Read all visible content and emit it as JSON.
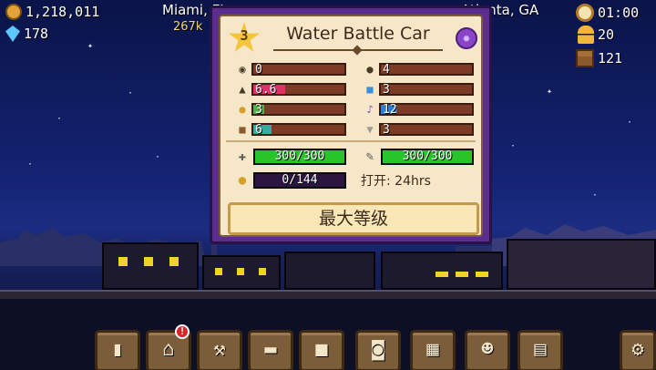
{
  "hud": {
    "coins": "1,218,011",
    "gems": "178",
    "time": "01:00",
    "passengers": "20",
    "cargo": "121"
  },
  "route": {
    "city_left": "Miami, FL",
    "distance": "267k",
    "city_right": "Atlanta, GA"
  },
  "card": {
    "level": "3",
    "title": "Water Battle Car",
    "stats": [
      {
        "icon": "speed-icon",
        "value": "0",
        "level": 0.0,
        "color": "#7b3b25"
      },
      {
        "icon": "weight-icon",
        "value": "6.6",
        "level": 0.35,
        "color": "#e0306a"
      },
      {
        "icon": "passenger-icon",
        "value": "3",
        "level": 0.12,
        "color": "#4cb34a"
      },
      {
        "icon": "cargo-icon",
        "value": "6",
        "level": 0.2,
        "color": "#3aa9a0"
      },
      {
        "icon": "bomb-icon",
        "value": "4",
        "level": 0.0,
        "color": "#7b3b25"
      },
      {
        "icon": "robot-icon",
        "value": "3",
        "level": 0.0,
        "color": "#7b3b25"
      },
      {
        "icon": "music-icon",
        "value": "12",
        "level": 0.18,
        "color": "#2b7fd1"
      },
      {
        "icon": "toilet-icon",
        "value": "3",
        "level": 0.0,
        "color": "#7b3b25"
      }
    ],
    "meters": {
      "durability": {
        "value": "300/300",
        "level": 1.0,
        "color": "#27c42a"
      },
      "cleanliness": {
        "value": "300/300",
        "level": 1.0,
        "color": "#27c42a"
      },
      "coins": {
        "value": "0/144",
        "level": 0.0,
        "color": "#5b2a9a"
      }
    },
    "open_label": "打开: 24hrs",
    "max_button": "最大等级"
  },
  "toolbar": {
    "notification_badge": "!"
  },
  "colors": {
    "frame": "#5a2d8e",
    "panel": "#f6e7c8",
    "sky": "#142373"
  }
}
